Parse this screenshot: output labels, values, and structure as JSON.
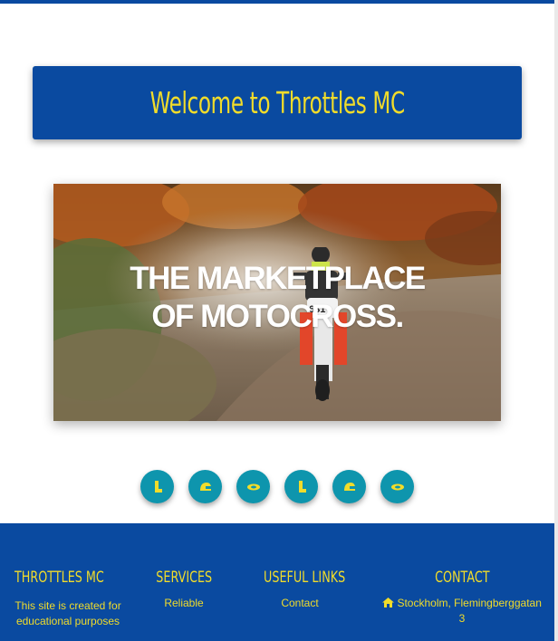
{
  "welcome": {
    "title": "Welcome to Throttles MC"
  },
  "hero": {
    "line1": "THE MARKETPLACE",
    "line2": "OF MOTOCROSS."
  },
  "icons": [
    "boot-icon",
    "helmet-icon",
    "goggles-icon",
    "boot-icon",
    "helmet-icon",
    "goggles-icon"
  ],
  "footer": {
    "brand": "THROTTLES MC",
    "brand_text": "This site is created for educational purposes",
    "services_heading": "SERVICES",
    "services_item": "Reliable",
    "links_heading": "USEFUL LINKS",
    "links_item": "Contact",
    "contact_heading": "CONTACT",
    "contact_address": "Stockholm, Flemingberggatan 3"
  },
  "colors": {
    "primary": "#0a4aa0",
    "accent": "#f1dc2a",
    "icon_bg": "#0e95ad"
  }
}
